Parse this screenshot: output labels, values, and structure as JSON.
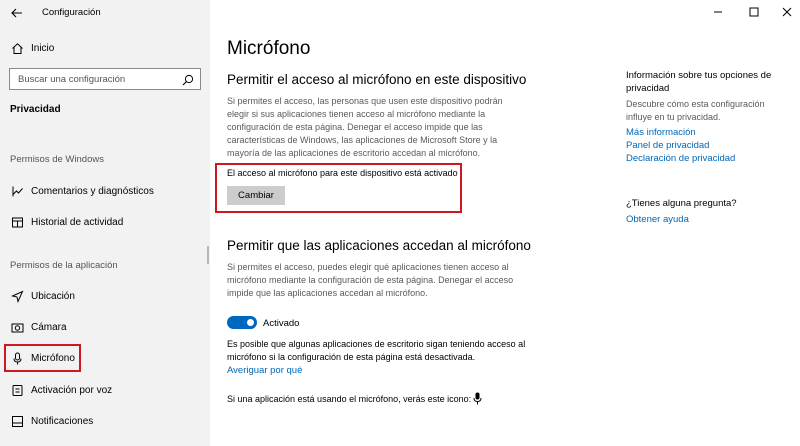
{
  "window": {
    "title": "Configuración"
  },
  "sidebar": {
    "home": "Inicio",
    "search_placeholder": "Buscar una configuración",
    "section": "Privacidad",
    "group_windows": "Permisos de Windows",
    "windows_items": [
      {
        "label": "Comentarios y diagnósticos",
        "icon": "feedback-icon"
      },
      {
        "label": "Historial de actividad",
        "icon": "activity-history-icon"
      }
    ],
    "group_app": "Permisos de la aplicación",
    "app_items": [
      {
        "label": "Ubicación",
        "icon": "location-icon"
      },
      {
        "label": "Cámara",
        "icon": "camera-icon"
      },
      {
        "label": "Micrófono",
        "icon": "microphone-icon",
        "selected": true
      },
      {
        "label": "Activación por voz",
        "icon": "voice-activation-icon"
      },
      {
        "label": "Notificaciones",
        "icon": "notifications-icon"
      }
    ]
  },
  "main": {
    "title": "Micrófono",
    "section1": {
      "heading": "Permitir el acceso al micrófono en este dispositivo",
      "description": "Si permites el acceso, las personas que usen este dispositivo podrán elegir si sus aplicaciones tienen acceso al micrófono mediante la configuración de esta página. Denegar el acceso impide que las características de Windows, las aplicaciones de Microsoft Store y la mayoría de las aplicaciones de escritorio accedan al micrófono.",
      "status": "El acceso al micrófono para este dispositivo está activado",
      "button": "Cambiar"
    },
    "section2": {
      "heading": "Permitir que las aplicaciones accedan al micrófono",
      "description": "Si permites el acceso, puedes elegir qué aplicaciones tienen acceso al micrófono mediante la configuración de esta página. Denegar el acceso impide que las aplicaciones accedan al micrófono.",
      "toggle_label": "Activado",
      "toggle_on": true,
      "note": "Es posible que algunas aplicaciones de escritorio sigan teniendo acceso al micrófono si la configuración de esta página está desactivada.",
      "link": "Averiguar por qué",
      "mic_in_use": "Si una aplicación está usando el micrófono, verás este icono:"
    }
  },
  "right_pane": {
    "info_title": "Información sobre tus opciones de privacidad",
    "info_desc": "Descubre cómo esta configuración influye en tu privacidad.",
    "links": [
      "Más información",
      "Panel de privacidad",
      "Declaración de privacidad"
    ],
    "question": "¿Tienes alguna pregunta?",
    "help_link": "Obtener ayuda"
  },
  "colors": {
    "accent": "#0067c0",
    "link": "#0067b8",
    "highlight": "#d0161e",
    "sidebar_bg": "#f2f2f2"
  }
}
